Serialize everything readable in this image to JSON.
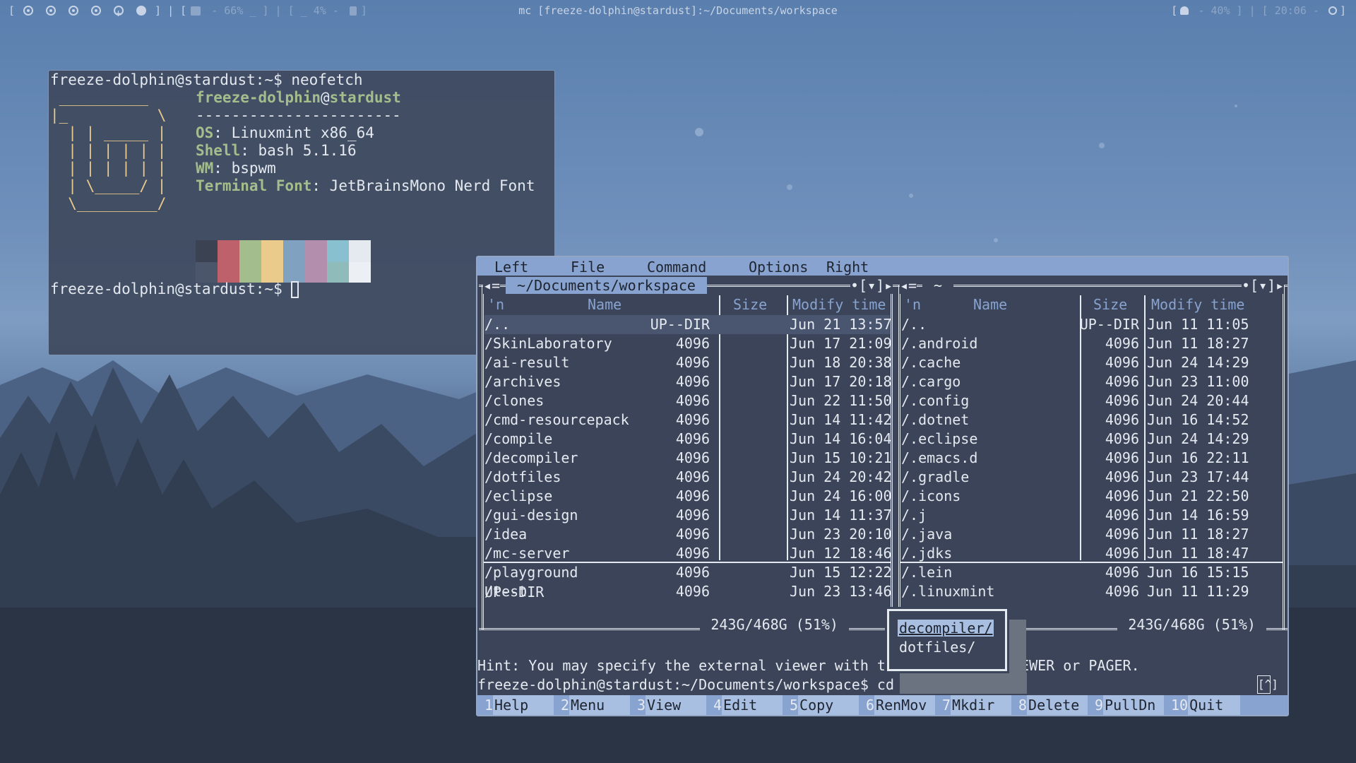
{
  "topbar": {
    "left_open": "[",
    "left_close": "] | [",
    "disk_text": " - 66% _ ] | [ _ 4% - ",
    "mem_close": "]",
    "title": "mc [freeze-dolphin@stardust]:~/Documents/workspace",
    "right_open": "[",
    "volume": " - 40% ] | [ 20:06 - ",
    "right_close": "]"
  },
  "neofetch": {
    "prompt_cmd": "freeze-dolphin@stardust:~$ neofetch",
    "logo": [
      " __________",
      "|_          \\",
      "  | | _____ |",
      "  | | | | | |",
      "  | | | | | |",
      "  | \\_____/ |",
      "  \\_________/"
    ],
    "user": "freeze-dolphin",
    "at": "@",
    "host": "stardust",
    "dashes": "-----------------------",
    "info": [
      {
        "key": "OS",
        "value": "Linuxmint x86_64"
      },
      {
        "key": "Shell",
        "value": "bash 5.1.16"
      },
      {
        "key": "WM",
        "value": "bspwm"
      },
      {
        "key": "Terminal Font",
        "value": "JetBrainsMono Nerd Font"
      }
    ],
    "palette_top": [
      "#3b4252",
      "#bf616a",
      "#a3be8c",
      "#ebcb8b",
      "#81a1c1",
      "#b48ead",
      "#88c0d0",
      "#e5e9f0"
    ],
    "palette_bottom": [
      "#4c566a",
      "#bf616a",
      "#a3be8c",
      "#ebcb8b",
      "#81a1c1",
      "#b48ead",
      "#8fbcbb",
      "#eceff4"
    ],
    "prompt": "freeze-dolphin@stardust:~$ "
  },
  "mc": {
    "menu": [
      "Left",
      "File",
      "Command",
      "Options",
      "Right"
    ],
    "left": {
      "path": " ~/Documents/workspace ",
      "sort": "'n",
      "col_name": "Name",
      "col_size": "Size",
      "col_time": "Modify time",
      "rows": [
        {
          "name": "/..",
          "size": "UP--DIR",
          "time": "Jun 21 13:57"
        },
        {
          "name": "/SkinLaboratory",
          "size": "4096",
          "time": "Jun 17 21:09"
        },
        {
          "name": "/ai-result",
          "size": "4096",
          "time": "Jun 18 20:38"
        },
        {
          "name": "/archives",
          "size": "4096",
          "time": "Jun 17 20:18"
        },
        {
          "name": "/clones",
          "size": "4096",
          "time": "Jun 22 11:50"
        },
        {
          "name": "/cmd-resourcepack",
          "size": "4096",
          "time": "Jun 14 11:42"
        },
        {
          "name": "/compile",
          "size": "4096",
          "time": "Jun 14 16:04"
        },
        {
          "name": "/decompiler",
          "size": "4096",
          "time": "Jun 15 10:21"
        },
        {
          "name": "/dotfiles",
          "size": "4096",
          "time": "Jun 24 20:42"
        },
        {
          "name": "/eclipse",
          "size": "4096",
          "time": "Jun 24 16:00"
        },
        {
          "name": "/gui-design",
          "size": "4096",
          "time": "Jun 14 11:37"
        },
        {
          "name": "/idea",
          "size": "4096",
          "time": "Jun 23 20:10"
        },
        {
          "name": "/mc-server",
          "size": "4096",
          "time": "Jun 12 18:46"
        },
        {
          "name": "/playground",
          "size": "4096",
          "time": "Jun 15 12:22"
        },
        {
          "name": "/test",
          "size": "4096",
          "time": "Jun 23 13:46"
        }
      ],
      "mini_status": "UP--DIR",
      "disk": " 243G/468G (51%) "
    },
    "right": {
      "path": " ~ ",
      "sort": "'n",
      "col_name": "Name",
      "col_size": "Size",
      "col_time": "Modify time",
      "rows": [
        {
          "name": "/..",
          "size": "UP--DIR",
          "time": "Jun 11 11:05"
        },
        {
          "name": "/.android",
          "size": "4096",
          "time": "Jun 11 18:27"
        },
        {
          "name": "/.cache",
          "size": "4096",
          "time": "Jun 24 14:29"
        },
        {
          "name": "/.cargo",
          "size": "4096",
          "time": "Jun 23 11:00"
        },
        {
          "name": "/.config",
          "size": "4096",
          "time": "Jun 24 20:44"
        },
        {
          "name": "/.dotnet",
          "size": "4096",
          "time": "Jun 16 14:52"
        },
        {
          "name": "/.eclipse",
          "size": "4096",
          "time": "Jun 24 14:29"
        },
        {
          "name": "/.emacs.d",
          "size": "4096",
          "time": "Jun 16 22:11"
        },
        {
          "name": "/.gradle",
          "size": "4096",
          "time": "Jun 23 17:44"
        },
        {
          "name": "/.icons",
          "size": "4096",
          "time": "Jun 21 22:50"
        },
        {
          "name": "/.j",
          "size": "4096",
          "time": "Jun 14 16:59"
        },
        {
          "name": "/.java",
          "size": "4096",
          "time": "Jun 11 18:27"
        },
        {
          "name": "/.jdks",
          "size": "4096",
          "time": "Jun 11 18:47"
        },
        {
          "name": "/.lein",
          "size": "4096",
          "time": "Jun 16 15:15"
        },
        {
          "name": "/.linuxmint",
          "size": "4096",
          "time": "Jun 11 11:29"
        }
      ],
      "disk": " 243G/468G (51%) "
    },
    "hint_left": "Hint: You may specify the external viewer with t",
    "hint_right": "IEWER or PAGER.",
    "cmd_prompt": "freeze-dolphin@stardust:~/Documents/workspace$ cd ",
    "cmd_input": "d",
    "caret_btn": "[^]",
    "popup": [
      "decompiler/",
      "dotfiles/"
    ],
    "fkeys": [
      {
        "num": "1",
        "label": "Help"
      },
      {
        "num": "2",
        "label": "Menu"
      },
      {
        "num": "3",
        "label": "View"
      },
      {
        "num": "4",
        "label": "Edit"
      },
      {
        "num": "5",
        "label": "Copy"
      },
      {
        "num": "6",
        "label": "RenMov"
      },
      {
        "num": "7",
        "label": "Mkdir"
      },
      {
        "num": "8",
        "label": "Delete"
      },
      {
        "num": "9",
        "label": "PullDn"
      },
      {
        "num": "10",
        "label": "Quit"
      }
    ]
  }
}
